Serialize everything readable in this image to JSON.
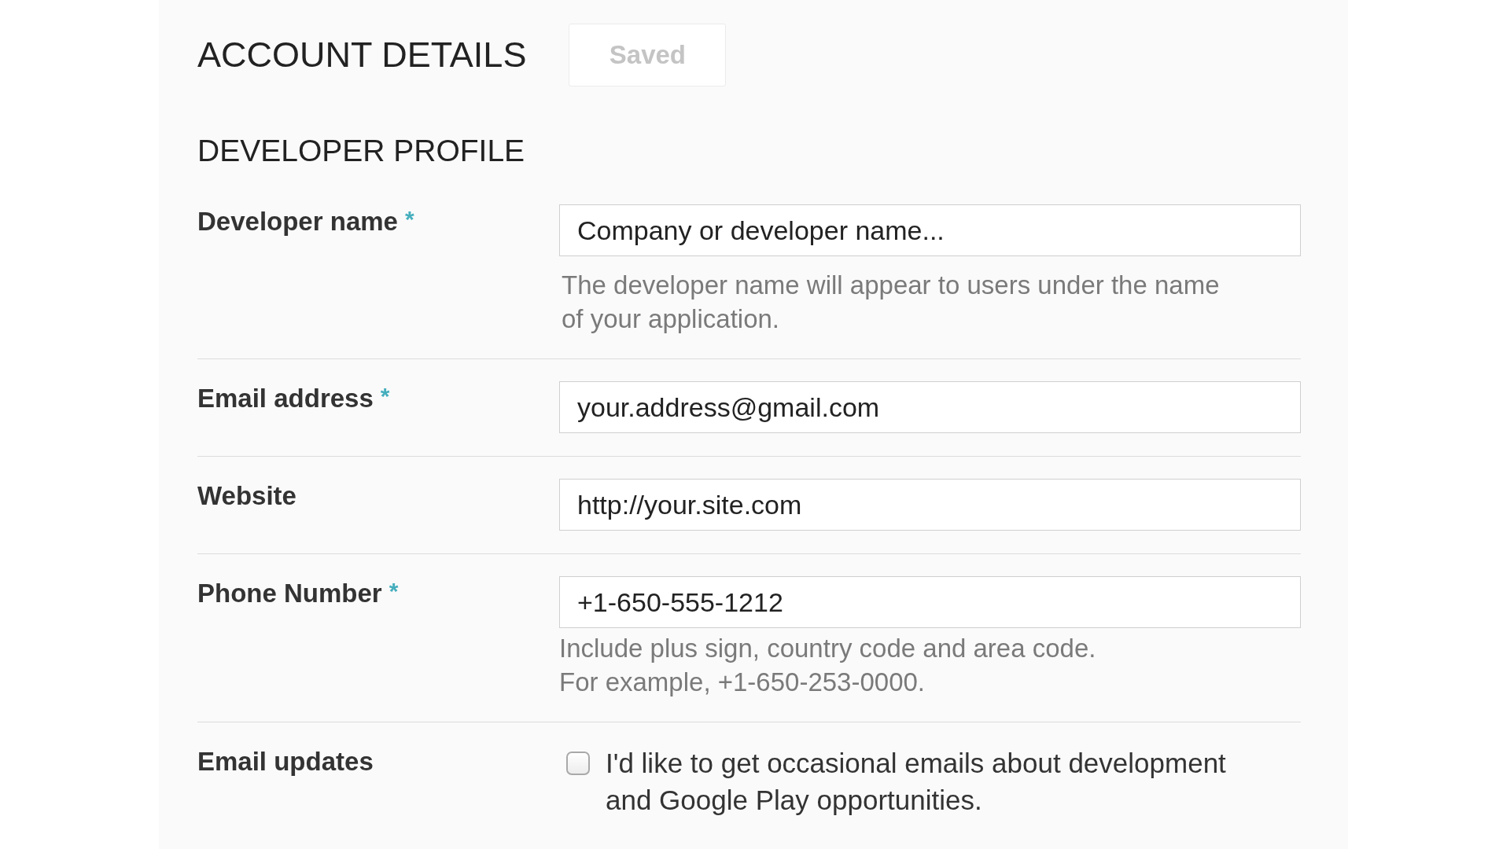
{
  "header": {
    "title": "ACCOUNT DETAILS",
    "save_button": {
      "label": "Saved",
      "disabled": true
    }
  },
  "section_title": "DEVELOPER PROFILE",
  "fields": [
    {
      "kind": "text",
      "label": "Developer name",
      "required_mark": "*",
      "placeholder": "Company or developer name...",
      "help": [
        "The developer name will appear to users under the name of your application."
      ]
    },
    {
      "kind": "text",
      "label": "Email address",
      "required_mark": "*",
      "placeholder": "your.address@gmail.com"
    },
    {
      "kind": "text",
      "label": "Website",
      "placeholder": "http://your.site.com"
    },
    {
      "kind": "text",
      "label": "Phone Number",
      "required_mark": "*",
      "placeholder": "+1-650-555-1212",
      "help": [
        "Include plus sign, country code and area code.",
        "For example, +1-650-253-0000."
      ]
    },
    {
      "kind": "checkbox",
      "label": "Email updates",
      "checked": false,
      "text": "I'd like to get occasional emails about development and Google Play opportunities."
    }
  ]
}
